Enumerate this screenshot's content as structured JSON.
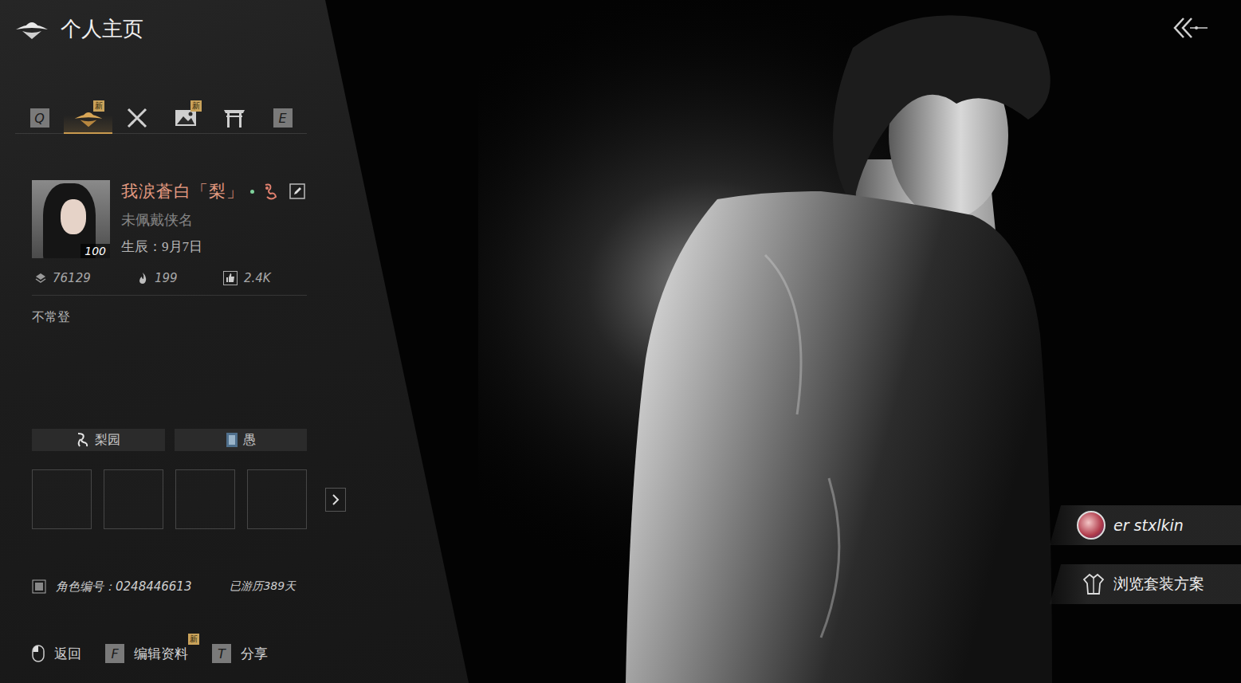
{
  "header": {
    "title": "个人主页"
  },
  "tabs": [
    {
      "kind": "key",
      "label": "Q",
      "selected": false
    },
    {
      "kind": "profile",
      "selected": true,
      "badge": "新"
    },
    {
      "kind": "combat",
      "selected": false
    },
    {
      "kind": "album",
      "selected": false,
      "badge": "新"
    },
    {
      "kind": "gate",
      "selected": false
    },
    {
      "kind": "key",
      "label": "E",
      "selected": false
    }
  ],
  "profile": {
    "avatar_level": "100",
    "name": "我涙蒼白「梨」",
    "title": "未佩戴侠名",
    "birthday": "生辰：9月7日"
  },
  "stats": [
    {
      "kind": "coins",
      "value": "76129"
    },
    {
      "kind": "heat",
      "value": "199"
    },
    {
      "kind": "likes",
      "value": "2.4K"
    }
  ],
  "signature": "不常登",
  "tags": [
    {
      "kind": "guild",
      "label": "梨园"
    },
    {
      "kind": "badge",
      "label": "愚"
    }
  ],
  "slots": [
    {
      "empty": true
    },
    {
      "empty": true
    },
    {
      "empty": true
    },
    {
      "empty": true
    }
  ],
  "role": {
    "id": "角色编号：0248446613",
    "days": "已游历389天"
  },
  "footer": [
    {
      "kind": "mouse",
      "key": "",
      "label": "返回"
    },
    {
      "kind": "key",
      "key": "F",
      "label": "编辑资料",
      "badge": "新"
    },
    {
      "kind": "key",
      "key": "T",
      "label": "分享"
    }
  ],
  "player_chip": {
    "label": "er stxlkin"
  },
  "outfit_button": {
    "label": "浏览套装方案"
  }
}
